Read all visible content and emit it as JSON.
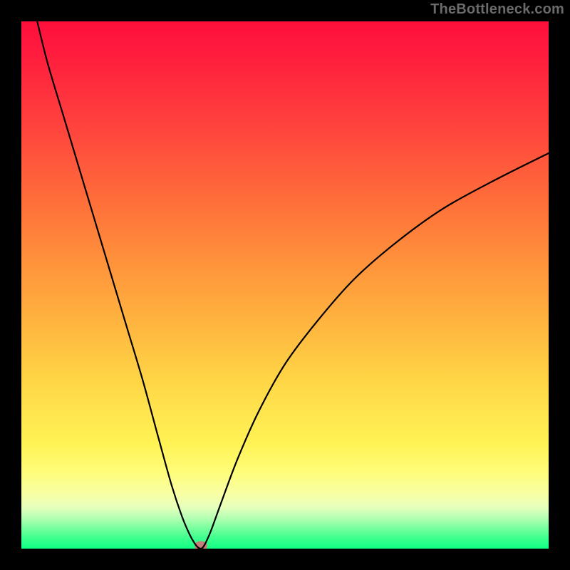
{
  "watermark": "TheBottleneck.com",
  "chart_data": {
    "type": "line",
    "title": "",
    "xlabel": "",
    "ylabel": "",
    "xlim": [
      0,
      100
    ],
    "ylim": [
      0,
      100
    ],
    "grid": false,
    "legend": false,
    "background": {
      "kind": "vertical-gradient",
      "stops": [
        {
          "pos": 0,
          "color": "#ff0f3b"
        },
        {
          "pos": 34,
          "color": "#ff6e3a"
        },
        {
          "pos": 57,
          "color": "#ffb43f"
        },
        {
          "pos": 75,
          "color": "#ffe750"
        },
        {
          "pos": 89,
          "color": "#f9ffa3"
        },
        {
          "pos": 96,
          "color": "#7cffa0"
        },
        {
          "pos": 100,
          "color": "#11ff85"
        }
      ]
    },
    "series": [
      {
        "name": "bottleneck-curve",
        "color": "#000000",
        "x": [
          3,
          5,
          8,
          11,
          14,
          17,
          20,
          23,
          26,
          28.5,
          30.5,
          32,
          33,
          33.6,
          34,
          34.4,
          35,
          36,
          38,
          41,
          45,
          50,
          56,
          63,
          71,
          80,
          90,
          100
        ],
        "y": [
          100,
          92,
          82,
          72,
          62,
          52,
          42,
          32,
          21,
          12,
          6,
          2.5,
          0.8,
          0.15,
          0,
          0.2,
          1.2,
          3.5,
          9,
          17,
          26,
          35,
          43,
          51,
          58,
          64.5,
          70,
          75
        ]
      }
    ],
    "marker": {
      "name": "optimum-point",
      "x": 34,
      "y": 0.6,
      "color": "#c57e79"
    }
  }
}
